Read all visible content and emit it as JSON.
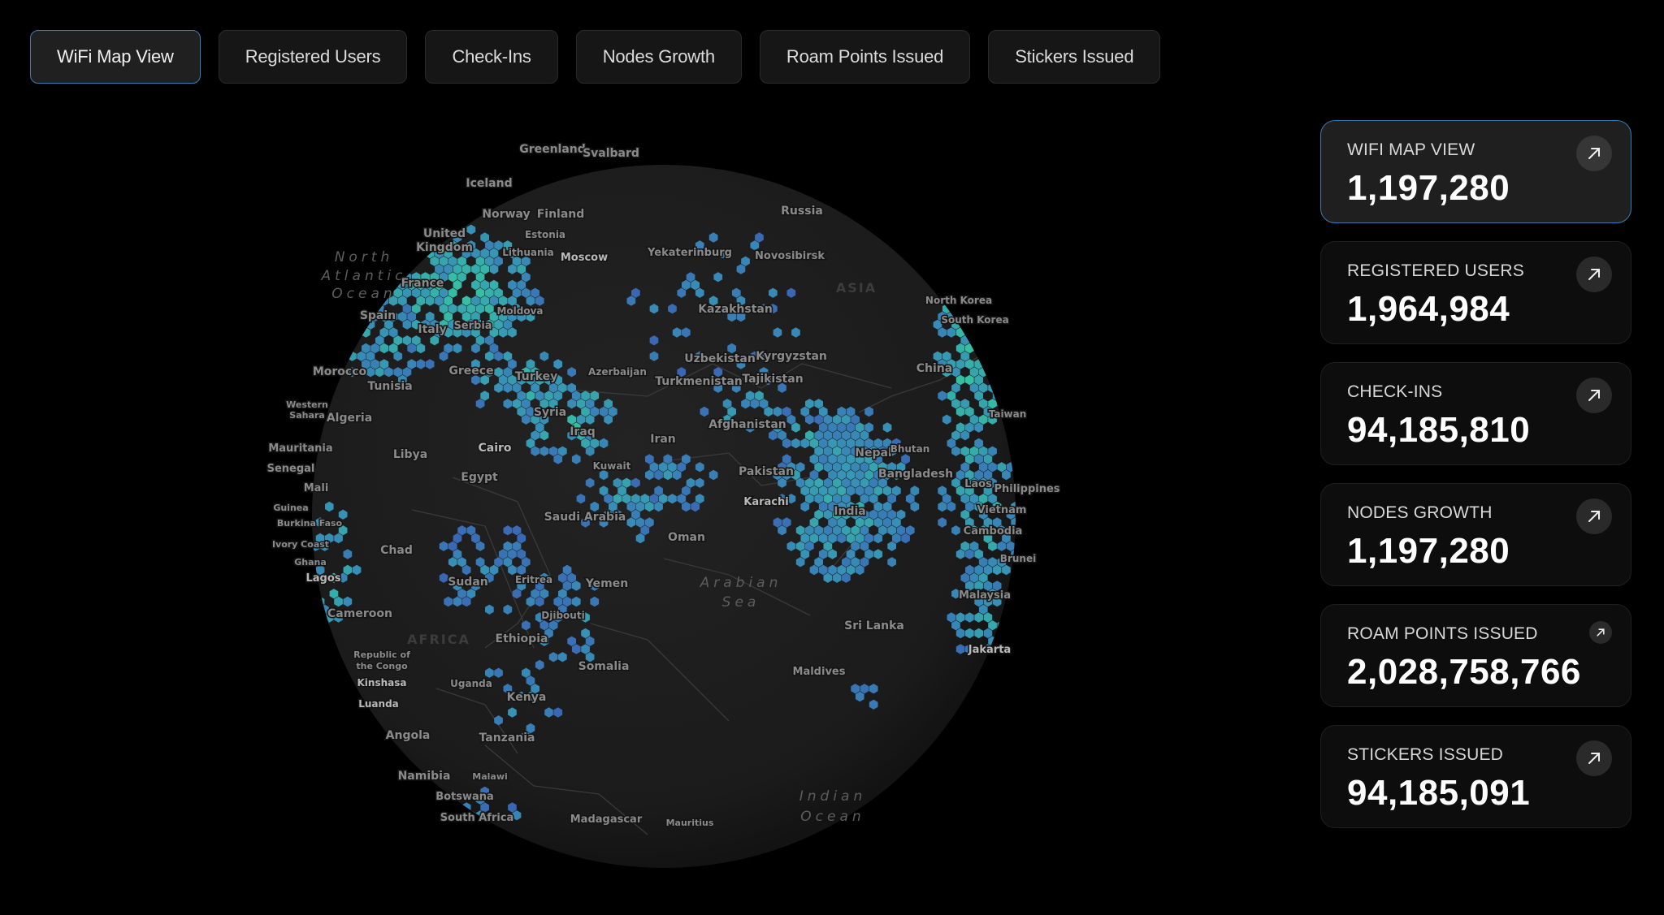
{
  "tabs": [
    {
      "label": "WiFi Map View",
      "active": true
    },
    {
      "label": "Registered Users",
      "active": false
    },
    {
      "label": "Check-Ins",
      "active": false
    },
    {
      "label": "Nodes Growth",
      "active": false
    },
    {
      "label": "Roam Points Issued",
      "active": false
    },
    {
      "label": "Stickers Issued",
      "active": false
    }
  ],
  "stats": [
    {
      "label": "WIFI MAP VIEW",
      "value": "1,197,280",
      "icon": "arrow-up-right-icon",
      "active": true
    },
    {
      "label": "REGISTERED USERS",
      "value": "1,964,984",
      "icon": "arrow-up-right-icon",
      "active": false
    },
    {
      "label": "CHECK-INS",
      "value": "94,185,810",
      "icon": "arrow-up-right-icon",
      "active": false
    },
    {
      "label": "NODES GROWTH",
      "value": "1,197,280",
      "icon": "arrow-up-right-icon",
      "active": false
    },
    {
      "label": "ROAM POINTS ISSUED",
      "value": "2,028,758,766",
      "icon": "arrow-up-right-icon",
      "active": false
    },
    {
      "label": "STICKERS ISSUED",
      "value": "94,185,091",
      "icon": "arrow-up-right-icon",
      "active": false
    }
  ],
  "map": {
    "colors": {
      "globe": "#1c1c1c",
      "hex_low": "#3d6fc4",
      "hex_mid": "#3b9bc7",
      "hex_high": "#38d6b0"
    },
    "labels": {
      "countries": [
        "Greenland",
        "Svalbard",
        "Iceland",
        "Norway",
        "Finland",
        "Estonia",
        "Lithuania",
        "Russia",
        "United Kingdom",
        "France",
        "Spain",
        "Italy",
        "Serbia",
        "Moldova",
        "Greece",
        "Turkey",
        "Azerbaijan",
        "Yekaterinburg",
        "Novosibirsk",
        "Kazakhstan",
        "Uzbekistan",
        "Kyrgyzstan",
        "Turkmenistan",
        "Tajikistan",
        "Afghanistan",
        "North Korea",
        "South Korea",
        "China",
        "Taiwan",
        "Morocco",
        "Tunisia",
        "Western Sahara",
        "Algeria",
        "Libya",
        "Syria",
        "Iraq",
        "Iran",
        "Kuwait",
        "Mauritania",
        "Senegal",
        "Mali",
        "Guinea",
        "Burkina Faso",
        "Ivory Coast",
        "Ghana",
        "Egypt",
        "Saudi Arabia",
        "Oman",
        "Pakistan",
        "Nepal",
        "Bhutan",
        "Bangladesh",
        "Laos",
        "Philippines",
        "Vietnam",
        "Cambodia",
        "Brunei",
        "Malaysia",
        "India",
        "Sri Lanka",
        "Maldives",
        "Chad",
        "Sudan",
        "Eritrea",
        "Yemen",
        "Djibouti",
        "Ethiopia",
        "Somalia",
        "Cameroon",
        "Republic of the Congo",
        "Uganda",
        "Kenya",
        "Tanzania",
        "Angola",
        "Malawi",
        "Namibia",
        "Botswana",
        "South Africa",
        "Madagascar",
        "Mauritius"
      ],
      "cities": [
        "Moscow",
        "Cairo",
        "Karachi",
        "Lagos",
        "Kinshasa",
        "Luanda",
        "Jakarta"
      ],
      "oceans": [
        "North Atlantic Ocean",
        "Arabian Sea",
        "Indian Ocean"
      ],
      "continents": [
        "ASIA",
        "AFRICA"
      ]
    }
  }
}
